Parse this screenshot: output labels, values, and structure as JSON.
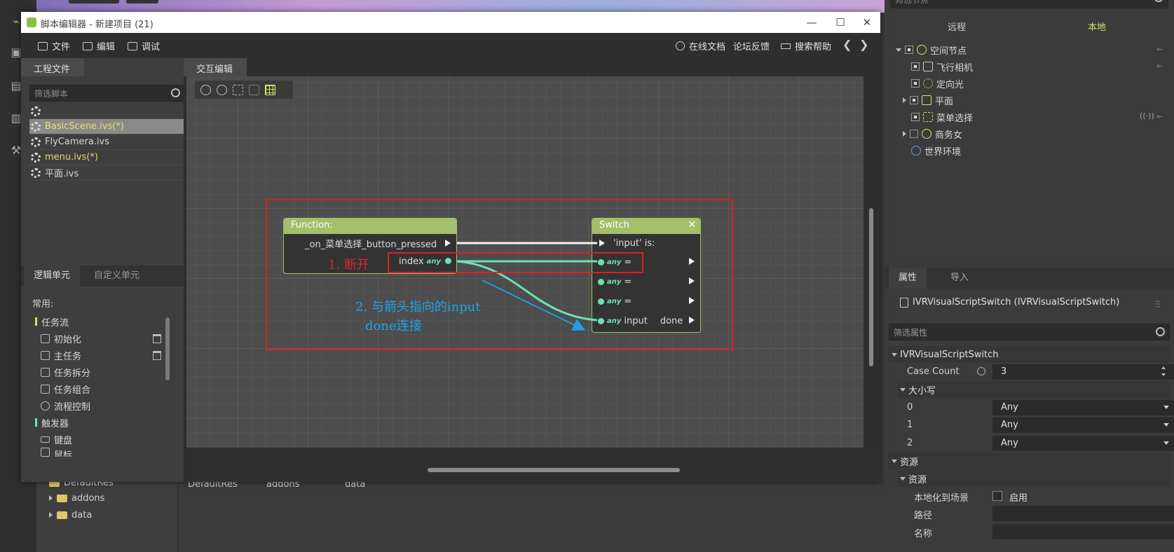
{
  "window": {
    "title": "脚本编辑器 - 新建项目 (21)"
  },
  "menu": {
    "file": "文件",
    "edit": "编辑",
    "debug": "调试",
    "online_docs": "在线文档",
    "forum": "论坛反馈",
    "search_help": "搜索帮助"
  },
  "project": {
    "tab": "工程文件",
    "filter_placeholder": "筛选脚本",
    "files": [
      {
        "name": ""
      },
      {
        "name": "BasicScene.ivs(*)"
      },
      {
        "name": "FlyCamera.ivs"
      },
      {
        "name": "menu.ivs(*)"
      },
      {
        "name": "平面.ivs"
      }
    ]
  },
  "logic": {
    "tabs": [
      "逻辑单元",
      "自定义单元"
    ],
    "common_label": "常用:",
    "items": [
      "任务流",
      "初始化",
      "主任务",
      "任务拆分",
      "任务组合",
      "流程控制",
      "触发器",
      "键盘",
      "鼠标"
    ]
  },
  "canvas": {
    "tab": "交互编辑"
  },
  "function_node": {
    "title": "Function:",
    "event": "_on_菜单选择_button_pressed",
    "index": "index",
    "any": "any"
  },
  "switch_node": {
    "title": "Switch",
    "input_is": "'input' is:",
    "eq": "=",
    "input": "input",
    "done": "done",
    "any": "any"
  },
  "annotations": {
    "step1": "1. 断开",
    "step2_line1": "2. 与箭头指向的input",
    "step2_line2": "done连接"
  },
  "bg_tree": {
    "items": [
      "DefaultRes",
      "addons",
      "data"
    ],
    "files": [
      "DefaultRes",
      "addons",
      "data"
    ]
  },
  "scene": {
    "filter_placeholder": "筛选节点",
    "tabs": {
      "remote": "远程",
      "local": "本地"
    },
    "nodes": [
      "空间节点",
      "飞行相机",
      "定向光",
      "平面",
      "菜单选择",
      "商务女",
      "世界环境"
    ]
  },
  "props": {
    "tabs": {
      "attr": "属性",
      "import": "导入"
    },
    "class_name": "IVRVisualScriptSwitch  (IVRVisualScriptSwitch)",
    "filter_placeholder": "筛选属性",
    "section_main": "IVRVisualScriptSwitch",
    "case_count_label": "Case Count",
    "case_count_value": "3",
    "section_case": "大小写",
    "cases": [
      {
        "label": "0",
        "value": "Any"
      },
      {
        "label": "1",
        "value": "Any"
      },
      {
        "label": "2",
        "value": "Any"
      }
    ],
    "section_res": "资源",
    "section_res2": "资源",
    "localize_label": "本地化到场景",
    "localize_value": "启用",
    "path_label": "路径",
    "name_label": "名称"
  },
  "colors": {
    "node_header": "#a4be6a",
    "pin": "#6fe0b6",
    "annotation_red": "#e01e1e",
    "annotation_blue": "#1ea3e6"
  }
}
